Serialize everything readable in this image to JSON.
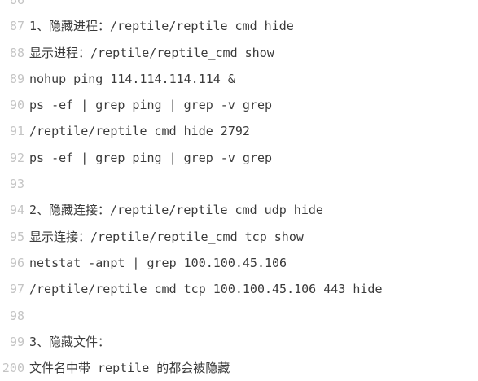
{
  "editor": {
    "lines": [
      {
        "number": "86",
        "text": ""
      },
      {
        "number": "87",
        "text": "1、隐藏进程：/reptile/reptile_cmd hide"
      },
      {
        "number": "88",
        "text": "显示进程：/reptile/reptile_cmd show"
      },
      {
        "number": "89",
        "text": "nohup ping 114.114.114.114 &"
      },
      {
        "number": "90",
        "text": "ps -ef | grep ping | grep -v grep"
      },
      {
        "number": "91",
        "text": "/reptile/reptile_cmd hide 2792"
      },
      {
        "number": "92",
        "text": "ps -ef | grep ping | grep -v grep"
      },
      {
        "number": "93",
        "text": ""
      },
      {
        "number": "94",
        "text": "2、隐藏连接：/reptile/reptile_cmd udp hide"
      },
      {
        "number": "95",
        "text": "显示连接：/reptile/reptile_cmd tcp show"
      },
      {
        "number": "96",
        "text": "netstat -anpt | grep 100.100.45.106"
      },
      {
        "number": "97",
        "text": "/reptile/reptile_cmd tcp 100.100.45.106 443 hide"
      },
      {
        "number": "98",
        "text": ""
      },
      {
        "number": "99",
        "text": "3、隐藏文件："
      },
      {
        "number": "200",
        "text": "文件名中带 reptile 的都会被隐藏"
      }
    ]
  }
}
